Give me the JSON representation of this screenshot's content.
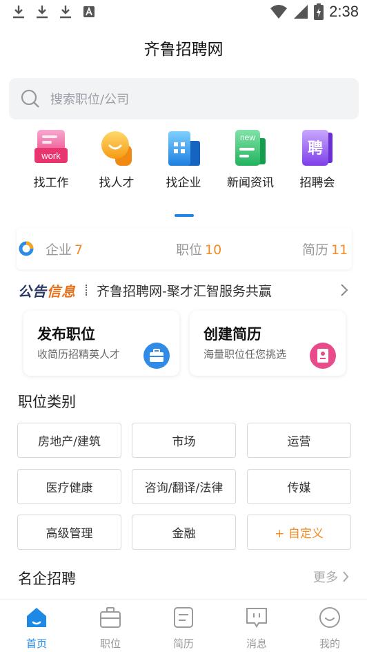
{
  "status_bar": {
    "time": "2:38"
  },
  "header": {
    "title": "齐鲁招聘网"
  },
  "search": {
    "placeholder": "搜索职位/公司"
  },
  "quick_nav": [
    {
      "label": "找工作",
      "icon": "work-icon",
      "badge": "work"
    },
    {
      "label": "找人才",
      "icon": "talent-icon"
    },
    {
      "label": "找企业",
      "icon": "company-icon"
    },
    {
      "label": "新闻资讯",
      "icon": "news-icon",
      "badge": "new"
    },
    {
      "label": "招聘会",
      "icon": "job-fair-icon",
      "badge": "聘"
    }
  ],
  "stats": [
    {
      "label": "企业",
      "value": "7"
    },
    {
      "label": "职位",
      "value": "10"
    },
    {
      "label": "简历",
      "value": "11"
    }
  ],
  "notice": {
    "logo_a": "公告",
    "logo_b": "信息",
    "text": "齐鲁招聘网-聚才汇智服务共赢"
  },
  "actions": [
    {
      "title": "发布职位",
      "subtitle": "收简历招精英人才",
      "icon": "briefcase-icon"
    },
    {
      "title": "创建简历",
      "subtitle": "海量职位任您挑选",
      "icon": "resume-icon"
    }
  ],
  "categories": {
    "title": "职位类别",
    "items": [
      "房地产/建筑",
      "市场",
      "运营",
      "医疗健康",
      "咨询/翻译/法律",
      "传媒",
      "高级管理",
      "金融",
      "+ 自定义"
    ]
  },
  "famous": {
    "title": "名企招聘",
    "more": "更多"
  },
  "bottom_nav": [
    {
      "label": "首页",
      "icon": "home-icon",
      "active": true
    },
    {
      "label": "职位",
      "icon": "briefcase-icon"
    },
    {
      "label": "简历",
      "icon": "resume-icon"
    },
    {
      "label": "消息",
      "icon": "message-icon"
    },
    {
      "label": "我的",
      "icon": "profile-icon"
    }
  ],
  "colors": {
    "accent": "#1e88e5",
    "highlight": "#f28a1f"
  }
}
